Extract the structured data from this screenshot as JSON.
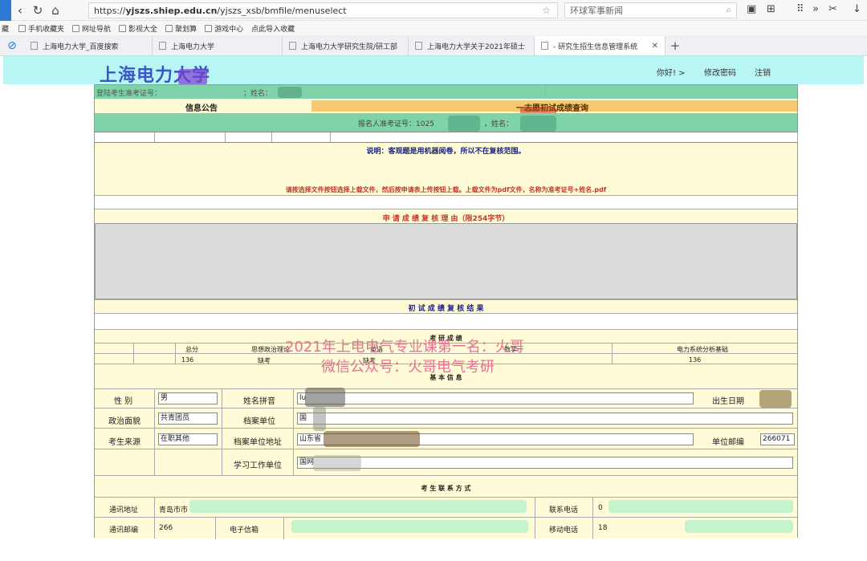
{
  "browser": {
    "url_prefix": "https://",
    "url_host": "yjszs.shiep.edu.cn",
    "url_path": "/yjszs_xsb/bmfile/menuselect",
    "search_placeholder": "环球军事新闻",
    "bookmarks": [
      "手机收藏夹",
      "网址导航",
      "影视大全",
      "聚划算",
      "游戏中心",
      "点此导入收藏"
    ],
    "tabs": [
      "上海电力大学_百度搜索",
      "上海电力大学",
      "上海电力大学研究生院/研工部",
      "上海电力大学关于2021年硕士",
      "- 研究生招生信息管理系统"
    ],
    "left_edge": "藏"
  },
  "header": {
    "logo": "上海电力大学",
    "greeting": "你好! >",
    "change_password": "修改密码",
    "logout": "注销"
  },
  "page": {
    "login_line": "登陆考生准考证号：",
    "login_name": "；姓名：",
    "notice_title": "信息公告",
    "query_title": "一志愿初试成绩查询",
    "applicant_line": "报名人准考证号：1025",
    "applicant_name": "，姓名：",
    "note": "说明：客观题是用机器阅卷，所以不在复核范围。",
    "upload_note": "请按选择文件按钮选择上载文件，然后按申请表上传按钮上载。上载文件为pdf文件，名称为准考证号+姓名.pdf",
    "reason_title": "申 请 成 绩 复 核 理 由（限254字节）",
    "result_title": "初 试 成 绩 复 核 结 果",
    "scores_title": "考 研 成 绩",
    "score_headers": [
      "总分",
      "思想政治理论",
      "英语",
      "数学一",
      "电力系统分析基础"
    ],
    "score_values": [
      "136",
      "缺考",
      "缺考",
      "",
      "136"
    ],
    "basic_info_title": "基 本 信 息",
    "contact_title": "考 生 联 系 方 式"
  },
  "basic": {
    "gender_label": "性 别",
    "gender": "男",
    "pinyin_label": "姓名拼音",
    "pinyin": "lu",
    "birth_label": "出生日期",
    "politics_label": "政治面貌",
    "politics": "共青团员",
    "archive_label": "档案单位",
    "archive": "国",
    "source_label": "考生来源",
    "source": "在职其他",
    "archive_addr_label": "档案单位地址",
    "archive_addr": "山东省",
    "postcode_label": "单位邮编",
    "postcode": "266071",
    "work_label": "学习工作单位",
    "work": "国网"
  },
  "contact": {
    "address_label": "通讯地址",
    "address": "青岛市市",
    "phone_label": "联系电话",
    "phone": "0",
    "postcode_label": "通讯邮编",
    "postcode": "266",
    "email_label": "电子信箱",
    "mobile_label": "移动电话",
    "mobile": "18"
  },
  "watermark": {
    "line1": "2021年上电电气专业课第一名：火哥",
    "line2": "微信公众号：火哥电气考研"
  },
  "colors": {
    "header_bg": "#b8f5f5",
    "logo": "#3a57c7",
    "green_band": "#7fd3a8",
    "cream": "#fffbd6",
    "orange": "#f6c870",
    "watermark": "#e35b8a"
  }
}
